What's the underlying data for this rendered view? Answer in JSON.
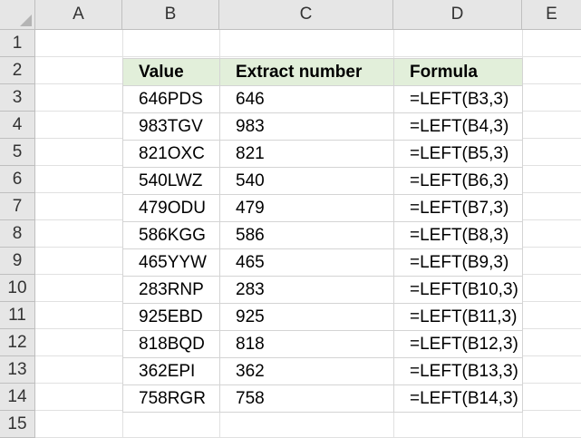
{
  "columns": [
    "A",
    "B",
    "C",
    "D",
    "E"
  ],
  "rows": [
    "1",
    "2",
    "3",
    "4",
    "5",
    "6",
    "7",
    "8",
    "9",
    "10",
    "11",
    "12",
    "13",
    "14",
    "15"
  ],
  "table": {
    "headers": [
      "Value",
      "Extract number",
      "Formula"
    ],
    "rows": [
      [
        "646PDS",
        "646",
        "=LEFT(B3,3)"
      ],
      [
        "983TGV",
        "983",
        "=LEFT(B4,3)"
      ],
      [
        "821OXC",
        "821",
        "=LEFT(B5,3)"
      ],
      [
        "540LWZ",
        "540",
        "=LEFT(B6,3)"
      ],
      [
        "479ODU",
        "479",
        "=LEFT(B7,3)"
      ],
      [
        "586KGG",
        "586",
        "=LEFT(B8,3)"
      ],
      [
        "465YYW",
        "465",
        "=LEFT(B9,3)"
      ],
      [
        "283RNP",
        "283",
        "=LEFT(B10,3)"
      ],
      [
        "925EBD",
        "925",
        "=LEFT(B11,3)"
      ],
      [
        "818BQD",
        "818",
        "=LEFT(B12,3)"
      ],
      [
        "362EPI",
        "362",
        "=LEFT(B13,3)"
      ],
      [
        "758RGR",
        "758",
        "=LEFT(B14,3)"
      ]
    ]
  },
  "colors": {
    "header_fill": "#e2efda",
    "grid": "#e1e1e1",
    "heading_bg": "#e6e6e6"
  }
}
